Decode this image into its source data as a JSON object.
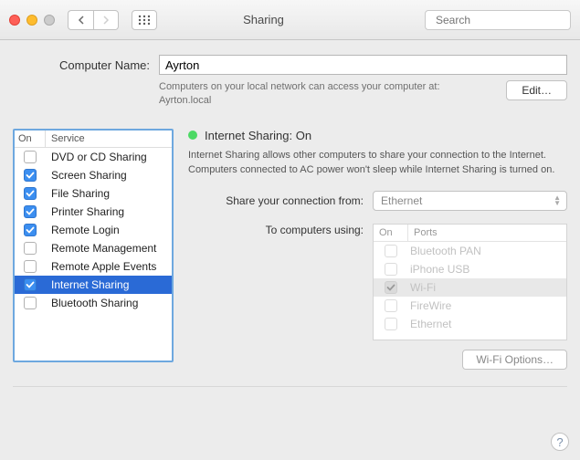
{
  "window": {
    "title": "Sharing",
    "search_placeholder": "Search"
  },
  "computer_name": {
    "label": "Computer Name:",
    "value": "Ayrton",
    "help_text": "Computers on your local network can access your computer at:",
    "local_name": "Ayrton.local",
    "edit_label": "Edit…"
  },
  "services": {
    "header_on": "On",
    "header_service": "Service",
    "items": [
      {
        "name": "DVD or CD Sharing",
        "on": false
      },
      {
        "name": "Screen Sharing",
        "on": true
      },
      {
        "name": "File Sharing",
        "on": true
      },
      {
        "name": "Printer Sharing",
        "on": true
      },
      {
        "name": "Remote Login",
        "on": true
      },
      {
        "name": "Remote Management",
        "on": false
      },
      {
        "name": "Remote Apple Events",
        "on": false
      },
      {
        "name": "Internet Sharing",
        "on": true,
        "selected": true
      },
      {
        "name": "Bluetooth Sharing",
        "on": false
      }
    ]
  },
  "detail": {
    "status_title": "Internet Sharing: On",
    "status_color": "#4cd964",
    "description": "Internet Sharing allows other computers to share your connection to the Internet. Computers connected to AC power won't sleep while Internet Sharing is turned on.",
    "share_from_label": "Share your connection from:",
    "share_from_value": "Ethernet",
    "to_computers_label": "To computers using:",
    "ports_header_on": "On",
    "ports_header_ports": "Ports",
    "ports": [
      {
        "name": "Bluetooth PAN",
        "on": false
      },
      {
        "name": "iPhone USB",
        "on": false
      },
      {
        "name": "Wi-Fi",
        "on": true,
        "selected": true
      },
      {
        "name": "FireWire",
        "on": false
      },
      {
        "name": "Ethernet",
        "on": false
      }
    ],
    "wifi_options_label": "Wi-Fi Options…"
  }
}
